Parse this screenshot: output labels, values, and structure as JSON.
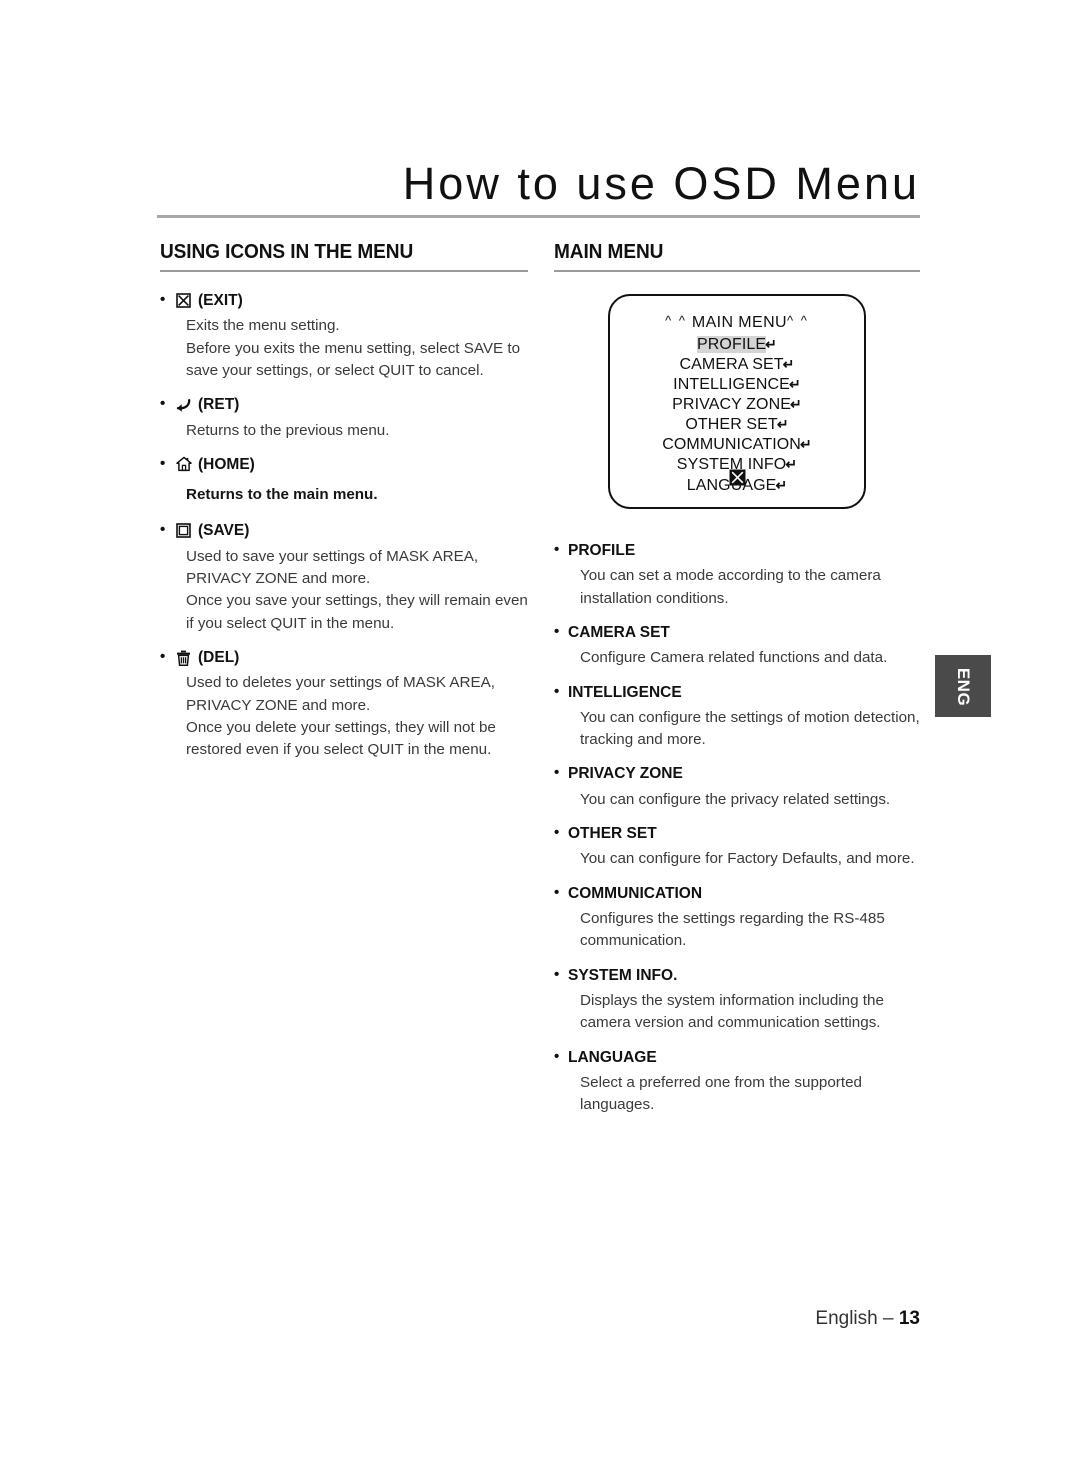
{
  "page": {
    "title": "How to use OSD Menu",
    "footer_label": "English –",
    "footer_page": "13",
    "side_tab": "ENG"
  },
  "left": {
    "header": "USING ICONS IN THE MENU",
    "entries": [
      {
        "icon": "exit-box-icon",
        "label": "(EXIT)",
        "body": "Exits the menu setting.\nBefore you exits the menu setting, select SAVE to save your settings, or select QUIT to cancel.",
        "bold": false
      },
      {
        "icon": "return-arrow-icon",
        "label": "(RET)",
        "body": "Returns to the previous menu.",
        "bold": false
      },
      {
        "icon": "home-icon",
        "label": "(HOME)",
        "body": "Returns to the main menu.",
        "bold": true
      },
      {
        "icon": "save-floppy-icon",
        "label": "(SAVE)",
        "body": "Used to save your settings of MASK AREA, PRIVACY ZONE and more.\nOnce you save your settings, they will remain even if you select QUIT in the menu.",
        "bold": false
      },
      {
        "icon": "trash-icon",
        "label": "(DEL)",
        "body": "Used to deletes your settings of MASK AREA, PRIVACY ZONE and more.\nOnce you delete your settings, they will not be restored even if you select QUIT in the menu.",
        "bold": false
      }
    ]
  },
  "right": {
    "header": "MAIN MENU",
    "osd": {
      "title": "MAIN MENU",
      "caret_left": "^ ^",
      "caret_right": "^ ^",
      "ret_glyph": "↵",
      "exit_icon": "exit-box-filled-icon",
      "items": [
        {
          "label": "PROFILE",
          "selected": true
        },
        {
          "label": "CAMERA SET",
          "selected": false
        },
        {
          "label": "INTELLIGENCE",
          "selected": false
        },
        {
          "label": "PRIVACY ZONE",
          "selected": false
        },
        {
          "label": "OTHER SET",
          "selected": false
        },
        {
          "label": "COMMUNICATION",
          "selected": false
        },
        {
          "label": "SYSTEM INFO",
          "selected": false
        },
        {
          "label": "LANGUAGE",
          "selected": false
        }
      ]
    },
    "entries": [
      {
        "label": "PROFILE",
        "body": "You can set a mode according to the camera installation conditions."
      },
      {
        "label": "CAMERA SET",
        "body": "Configure Camera related functions and data."
      },
      {
        "label": "INTELLIGENCE",
        "body": "You can configure the settings of motion detection, tracking and more."
      },
      {
        "label": "PRIVACY ZONE",
        "body": "You can configure the privacy related settings."
      },
      {
        "label": "OTHER SET",
        "body": "You can configure for Factory Defaults, and more."
      },
      {
        "label": "COMMUNICATION",
        "body": "Configures the settings regarding the RS-485 communication."
      },
      {
        "label": "SYSTEM INFO.",
        "body": "Displays the system information including the camera version and communication settings."
      },
      {
        "label": "LANGUAGE",
        "body": "Select a preferred one from the supported languages."
      }
    ]
  }
}
